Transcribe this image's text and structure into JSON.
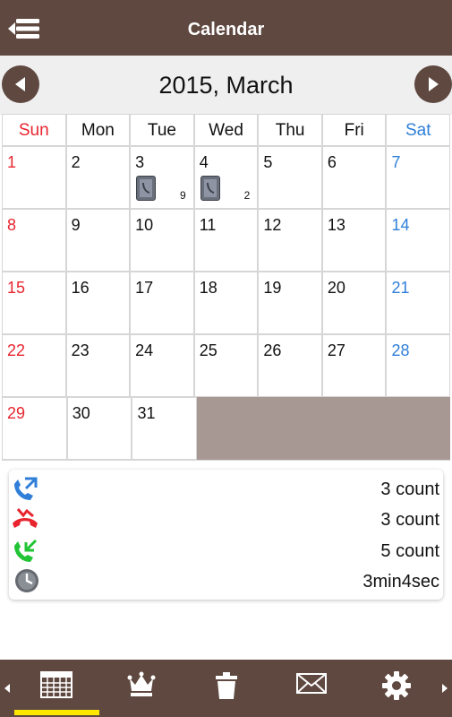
{
  "app_title": "Calendar",
  "month_title": "2015, March",
  "weekdays": [
    "Sun",
    "Mon",
    "Tue",
    "Wed",
    "Thu",
    "Fri",
    "Sat"
  ],
  "weeks": [
    [
      {
        "d": "1"
      },
      {
        "d": "2"
      },
      {
        "d": "3",
        "count": "9"
      },
      {
        "d": "4",
        "count": "2"
      },
      {
        "d": "5"
      },
      {
        "d": "6"
      },
      {
        "d": "7"
      }
    ],
    [
      {
        "d": "8"
      },
      {
        "d": "9"
      },
      {
        "d": "10"
      },
      {
        "d": "11"
      },
      {
        "d": "12"
      },
      {
        "d": "13"
      },
      {
        "d": "14"
      }
    ],
    [
      {
        "d": "15"
      },
      {
        "d": "16"
      },
      {
        "d": "17"
      },
      {
        "d": "18"
      },
      {
        "d": "19"
      },
      {
        "d": "20"
      },
      {
        "d": "21"
      }
    ],
    [
      {
        "d": "22"
      },
      {
        "d": "23"
      },
      {
        "d": "24"
      },
      {
        "d": "25"
      },
      {
        "d": "26"
      },
      {
        "d": "27"
      },
      {
        "d": "28"
      }
    ],
    [
      {
        "d": "29"
      },
      {
        "d": "30"
      },
      {
        "d": "31"
      },
      {
        "d": ""
      },
      {
        "d": ""
      },
      {
        "d": ""
      },
      {
        "d": ""
      }
    ]
  ],
  "summary": {
    "outgoing": {
      "icon": "outgoing-call-icon",
      "value": "3 count"
    },
    "missed": {
      "icon": "missed-call-icon",
      "value": "3 count"
    },
    "incoming": {
      "icon": "incoming-call-icon",
      "value": "5 count"
    },
    "duration": {
      "icon": "clock-icon",
      "value": "3min4sec"
    }
  },
  "bottom_nav": [
    "calendar-icon",
    "crown-icon",
    "trash-icon",
    "mail-icon",
    "settings-icon"
  ],
  "colors": {
    "brand": "#5e4840",
    "sunday": "#e8252f",
    "saturday": "#2f7fd9",
    "active_indicator": "#ffe800",
    "out_of_month": "#a79893"
  }
}
